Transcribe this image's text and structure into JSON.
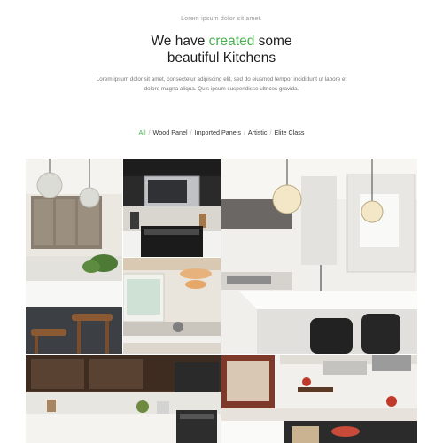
{
  "hero": {
    "eyebrow": "Lorem ipsum dolor sit amet.",
    "headline_part1": "We have",
    "headline_accent": "created",
    "headline_part2": "some",
    "headline_line2": "beautiful Kitchens",
    "description": "Lorem ipsum dolor sit amet, consectetur adipiscing elit, sed do eiusmod tempor incididunt ut labore et dolore magna aliqua. Quis ipsum suspendisse ultrices gravida."
  },
  "filters": [
    {
      "label": "All",
      "active": true
    },
    {
      "label": "Wood Panel",
      "active": false
    },
    {
      "label": "Imported Panels",
      "active": false
    },
    {
      "label": "Artistic",
      "active": false
    },
    {
      "label": "Elite Class",
      "active": false
    }
  ],
  "gallery": [
    {
      "subject": "kitchen-island-pendant-lights"
    },
    {
      "subject": "microwave-and-stove-dark-cabinets"
    },
    {
      "subject": "bright-kitchen-with-copper-lights"
    },
    {
      "subject": "white-island-kitchen-with-black-stools"
    },
    {
      "subject": "dark-wood-cabinet-kitchen"
    },
    {
      "subject": "kitchen-with-red-accessories"
    }
  ],
  "colors": {
    "accent": "#4caf50",
    "heading": "#1e1e1e",
    "muted": "#9a9a9a"
  }
}
